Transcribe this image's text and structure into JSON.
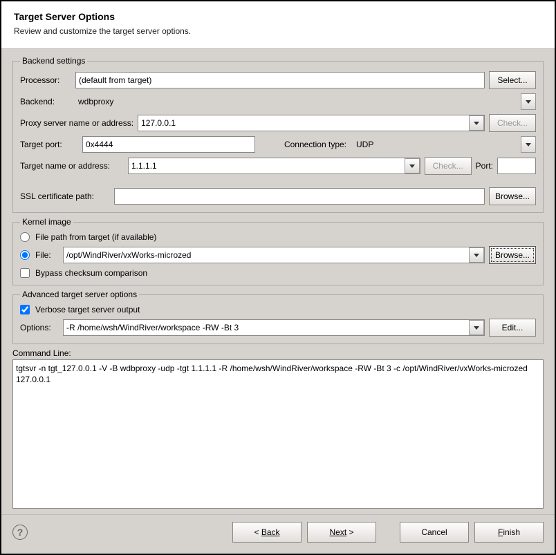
{
  "header": {
    "title": "Target Server Options",
    "subtitle": "Review and customize the target server options."
  },
  "backend": {
    "legend": "Backend settings",
    "processor_label": "Processor:",
    "processor_value": "(default from target)",
    "select_btn": "Select...",
    "backend_label": "Backend:",
    "backend_value": "wdbproxy",
    "proxy_label": "Proxy server name or address:",
    "proxy_value": "127.0.0.1",
    "check_btn": "Check...",
    "target_port_label": "Target port:",
    "target_port_value": "0x4444",
    "conn_type_label": "Connection type:",
    "conn_type_value": "UDP",
    "target_addr_label": "Target name or address:",
    "target_addr_value": "1.1.1.1",
    "port_label": "Port:",
    "port_value": "",
    "ssl_label": "SSL certificate path:",
    "ssl_value": "",
    "browse_btn": "Browse..."
  },
  "kernel": {
    "legend": "Kernel image",
    "radio_target": "File path from target (if available)",
    "radio_file": "File:",
    "file_value": "/opt/WindRiver/vxWorks-microzed",
    "browse_btn": "Browse...",
    "bypass": "Bypass checksum comparison"
  },
  "advanced": {
    "legend": "Advanced target server options",
    "verbose": "Verbose target server output",
    "options_label": "Options:",
    "options_value": "-R /home/wsh/WindRiver/workspace -RW -Bt 3",
    "edit_btn": "Edit..."
  },
  "cmd": {
    "label": "Command Line:",
    "value": "tgtsvr -n tgt_127.0.0.1 -V -B wdbproxy -udp -tgt 1.1.1.1 -R /home/wsh/WindRiver/workspace -RW -Bt 3 -c /opt/WindRiver/vxWorks-microzed 127.0.0.1"
  },
  "footer": {
    "back": "Back",
    "next": "Next",
    "cancel": "Cancel",
    "finish": "Finish"
  }
}
